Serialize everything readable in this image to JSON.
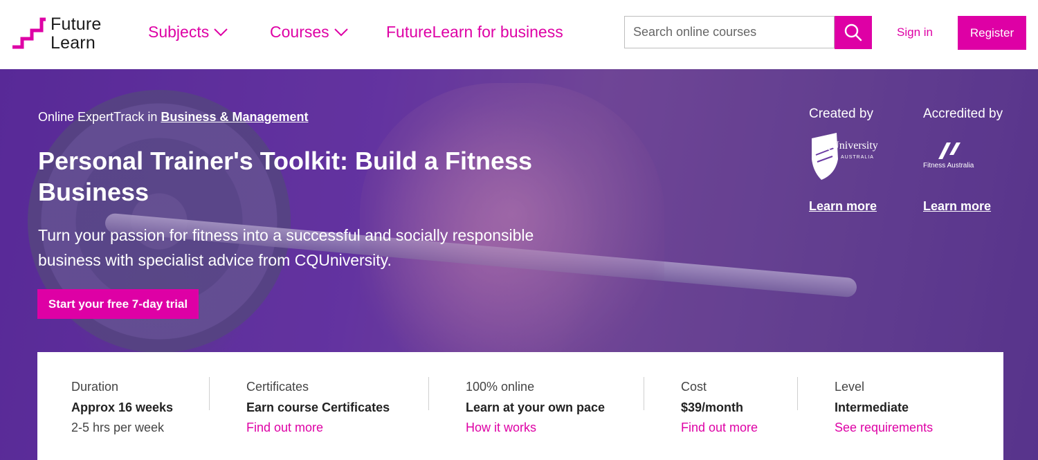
{
  "brand": {
    "logo_line1": "Future",
    "logo_line2": "Learn",
    "accent": "#de00a5"
  },
  "nav": {
    "subjects": "Subjects",
    "courses": "Courses",
    "business": "FutureLearn for business"
  },
  "search": {
    "placeholder": "Search online courses",
    "icon": "search-icon"
  },
  "auth": {
    "signin": "Sign in",
    "register": "Register"
  },
  "hero": {
    "breadcrumb_prefix": "Online ExpertTrack in",
    "breadcrumb_link": "Business & Management",
    "title": "Personal Trainer's Toolkit: Build a Fitness Business",
    "subtitle": "Turn your passion for fitness into a successful and socially responsible business with specialist advice from CQUniversity.",
    "cta": "Start your free 7-day trial"
  },
  "partners": {
    "created_label": "Created by",
    "created_logo": {
      "main": "CQUniversity",
      "sub": "AUSTRALIA"
    },
    "created_link": "Learn more",
    "accredited_label": "Accredited by",
    "accredited_logo": {
      "main": "Fitness Australia"
    },
    "accredited_link": "Learn more"
  },
  "info": [
    {
      "key": "Duration",
      "value": "Approx 16 weeks",
      "sub": "2-5 hrs per week",
      "link": ""
    },
    {
      "key": "Certificates",
      "value": "Earn course Certificates",
      "sub": "",
      "link": "Find out more"
    },
    {
      "key": "100% online",
      "value": "Learn at your own pace",
      "sub": "",
      "link": "How it works"
    },
    {
      "key": "Cost",
      "value": "$39/month",
      "sub": "",
      "link": "Find out more"
    },
    {
      "key": "Level",
      "value": "Intermediate",
      "sub": "",
      "link": "See requirements"
    }
  ]
}
